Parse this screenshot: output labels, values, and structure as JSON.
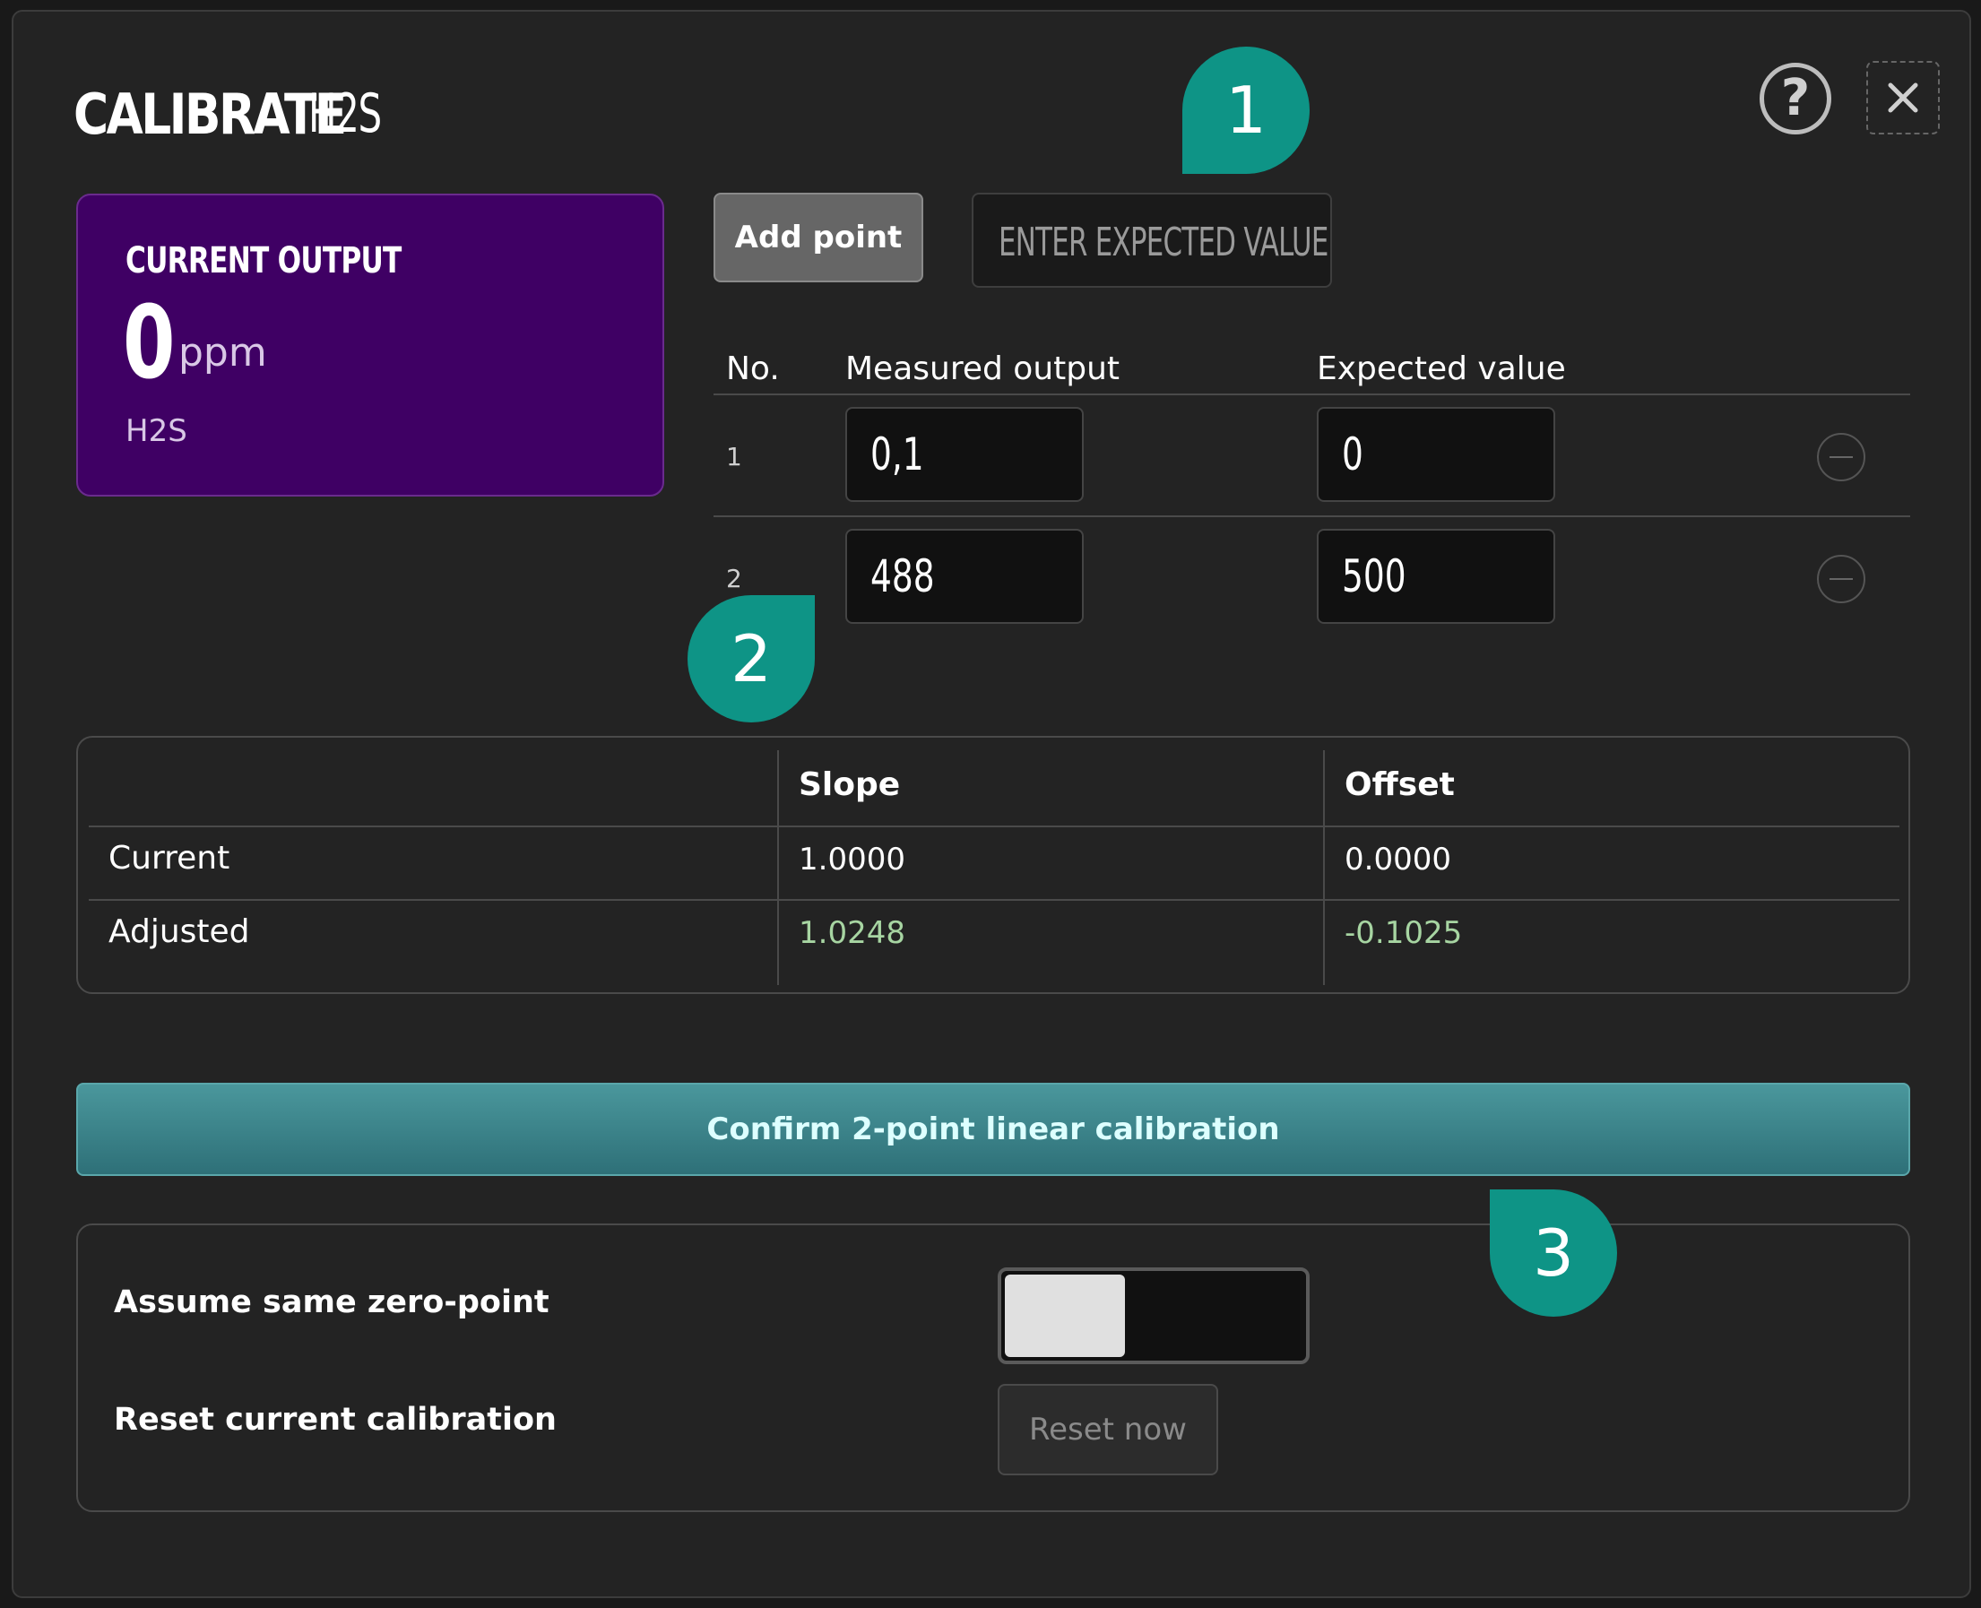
{
  "dialog": {
    "title_action": "CALIBRATE",
    "title_sensor": "H2S",
    "help_icon_glyph": "?",
    "close_icon_glyph": "✕"
  },
  "current_output": {
    "label": "CURRENT OUTPUT",
    "value": "0",
    "unit": "ppm",
    "gas": "H2S",
    "card_color": "#3f0064"
  },
  "points": {
    "add_point_label": "Add point",
    "expected_placeholder": "ENTER EXPECTED VALUE",
    "columns": {
      "no": "No.",
      "measured": "Measured output",
      "expected": "Expected value"
    },
    "rows": [
      {
        "no": "1",
        "measured": "0,1",
        "expected": "0"
      },
      {
        "no": "2",
        "measured": "488",
        "expected": "500"
      }
    ]
  },
  "calibration": {
    "columns": {
      "slope": "Slope",
      "offset": "Offset"
    },
    "current": {
      "label": "Current",
      "slope": "1.0000",
      "offset": "0.0000"
    },
    "adjusted": {
      "label": "Adjusted",
      "slope": "1.0248",
      "offset": "-0.1025",
      "color": "#a7d5a2"
    }
  },
  "confirm_label": "Confirm 2-point linear calibration",
  "options": {
    "zero_point_label": "Assume same zero-point",
    "zero_point_enabled": false,
    "reset_label": "Reset current calibration",
    "reset_button": "Reset now"
  },
  "markers": [
    "1",
    "2",
    "3"
  ],
  "accent_color": "#0e9486"
}
